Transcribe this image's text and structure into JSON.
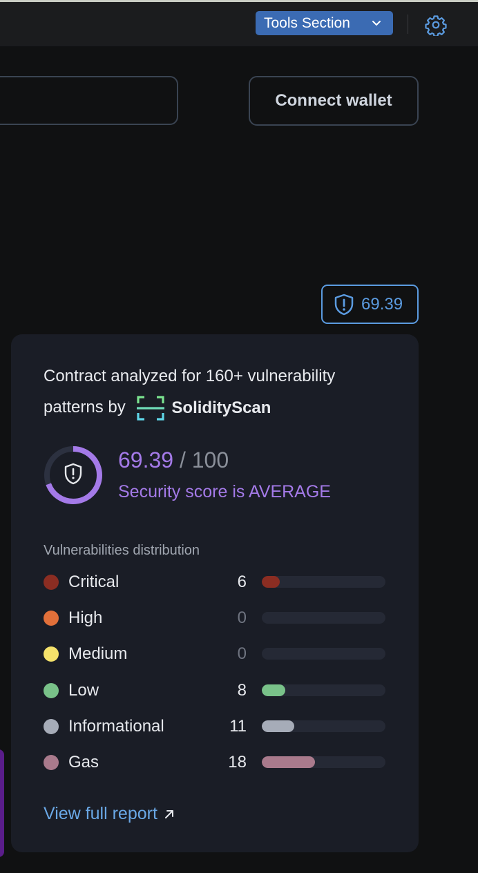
{
  "header": {
    "tools_label": "Tools Section"
  },
  "wallet": {
    "connect_label": "Connect wallet"
  },
  "score_chip": {
    "value": "69.39"
  },
  "panel": {
    "intro_text": "Contract analyzed for 160+ vulnerability patterns by",
    "brand_name": "SolidityScan",
    "score_value": "69.39",
    "score_max": "/ 100",
    "score_fraction": 0.6939,
    "score_text": "Security score is AVERAGE",
    "distribution_title": "Vulnerabilities distribution",
    "rows": [
      {
        "label": "Critical",
        "count": "6",
        "value": 6,
        "color": "#8b2d22"
      },
      {
        "label": "High",
        "count": "0",
        "value": 0,
        "color": "#e2703a"
      },
      {
        "label": "Medium",
        "count": "0",
        "value": 0,
        "color": "#f5e26b"
      },
      {
        "label": "Low",
        "count": "8",
        "value": 8,
        "color": "#79c289"
      },
      {
        "label": "Informational",
        "count": "11",
        "value": 11,
        "color": "#a6acb8"
      },
      {
        "label": "Gas",
        "count": "18",
        "value": 18,
        "color": "#a97a8c"
      }
    ],
    "report_label": "View full report"
  },
  "colors": {
    "accent_blue": "#3b6bb3",
    "score_purple": "#a47ae8",
    "link_blue": "#6aa8e6"
  }
}
